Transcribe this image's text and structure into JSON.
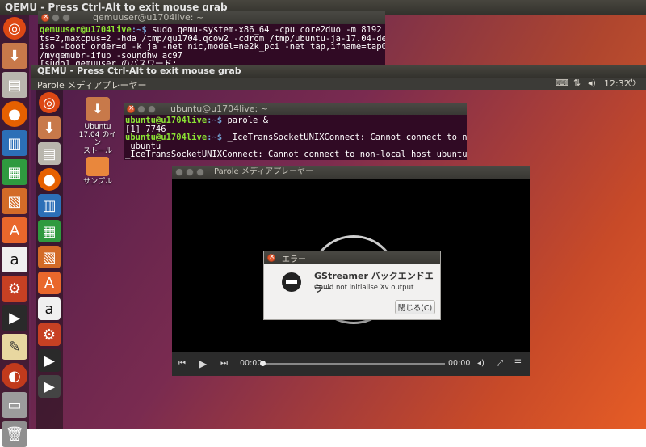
{
  "outer_window": {
    "title": "QEMU - Press Ctrl-Alt to exit mouse grab"
  },
  "outer_terminal": {
    "title": "qemuuser@u1704live: ~",
    "prompt": "qemuuser@u1704live",
    "path": ":~$",
    "command_lines": [
      " sudo qemu-system-x86_64 -cpu core2duo -m 8192 -smp 1,socke",
      "ts=2,maxcpus=2 -hda /tmp/qu1704.qcow2 -cdrom /tmp/ubuntu-ja-17.04-desktop-amd64.",
      "iso -boot order=d -k ja -net nic,model=ne2k_pci -net tap,ifname=tap0,script=/etc",
      "/myqemubr-ifup -soundhw ac97"
    ],
    "sudo_line": "[sudo] qemuuser のパスワード:"
  },
  "inner_window": {
    "title": "QEMU - Press Ctrl-Alt to exit mouse grab",
    "topbar_app": "Parole メディアプレーヤー",
    "clock": "12:32"
  },
  "desktop_icons": [
    {
      "name": "ubuntu-installer-icon",
      "label": "Ubuntu\n17.04 のイン\nストール"
    },
    {
      "name": "sample-folder-icon",
      "label": "サンプル"
    }
  ],
  "inner_terminal": {
    "title": "ubuntu@u1704live: ~",
    "lines": [
      {
        "prompt": "ubuntu@u1704live",
        "path": ":~$",
        "text": " parole &"
      },
      {
        "text": "[1] 7746"
      },
      {
        "prompt": "ubuntu@u1704live",
        "path": ":~$",
        "text": " _IceTransSocketUNIXConnect: Cannot connect to non-local host"
      },
      {
        "text": " ubuntu"
      },
      {
        "text": "_IceTransSocketUNIXConnect: Cannot connect to non-local host ubuntu"
      }
    ]
  },
  "parole": {
    "title": "Parole メディアプレーヤー",
    "time_current": "00:00",
    "time_total": "00:00",
    "progress": 0
  },
  "error_dialog": {
    "title": "エラー",
    "heading": "GStreamer バックエンドエラー",
    "message": "Could not initialise Xv output",
    "close_button": "閉じる(C)"
  },
  "colors": {
    "terminal_bg": "#300a24",
    "prompt_green": "#8ae234",
    "path_blue": "#729fcf",
    "titlebar": "#3c3b37",
    "close_orange": "#e0582e"
  }
}
